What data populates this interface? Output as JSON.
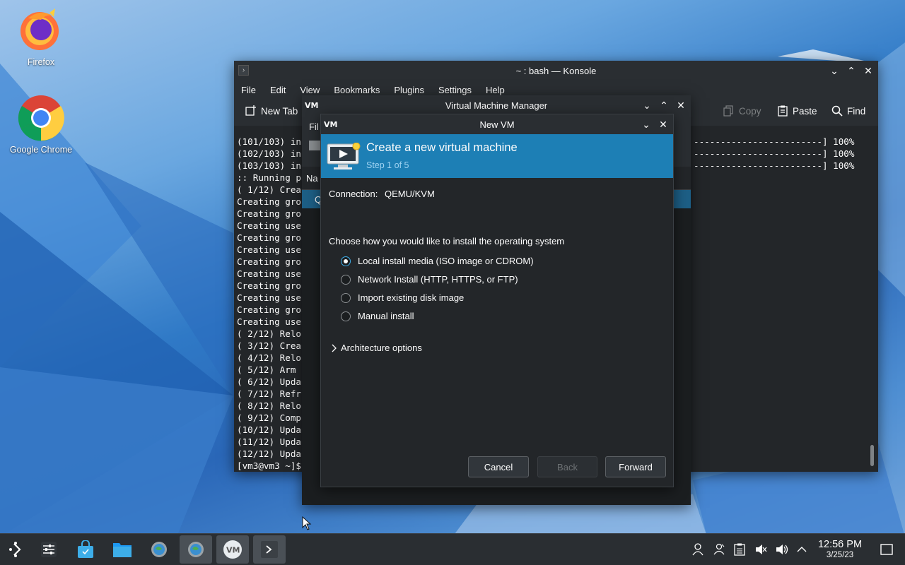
{
  "desktop": {
    "icons": [
      {
        "label": "Firefox"
      },
      {
        "label": "Google Chrome"
      }
    ]
  },
  "konsole": {
    "title": "~ : bash — Konsole",
    "menu": [
      "File",
      "Edit",
      "View",
      "Bookmarks",
      "Plugins",
      "Settings",
      "Help"
    ],
    "toolbar": {
      "new_tab": "New Tab",
      "copy": "Copy",
      "paste": "Paste",
      "find": "Find"
    },
    "lines_left": [
      "(101/103) in",
      "(102/103) in",
      "(103/103) in",
      ":: Running p",
      "( 1/12) Crea",
      "Creating gro",
      "Creating gro",
      "Creating use",
      "Creating gro",
      "Creating use",
      "Creating gro",
      "Creating use",
      "Creating gro",
      "Creating use",
      "Creating gro",
      "Creating use",
      "( 2/12) Relo",
      "( 3/12) Crea",
      "( 4/12) Relo",
      "( 5/12) Arm",
      "( 6/12) Upda",
      "( 7/12) Refr",
      "( 8/12) Relo",
      "( 9/12) Comp",
      "(10/12) Upda",
      "(11/12) Upda",
      "(12/12) Upda",
      "[vm3@vm3 ~]$"
    ],
    "lines_right": [
      "------------------------] 100%",
      "------------------------] 100%",
      "------------------------] 100%"
    ]
  },
  "vmm": {
    "title": "Virtual Machine Manager",
    "menu_fragment": "Fil",
    "header_fragment": "Na",
    "row_fragment": "Q"
  },
  "newvm": {
    "title": "New VM",
    "banner_title": "Create a new virtual machine",
    "banner_step": "Step 1 of 5",
    "connection_label": "Connection:",
    "connection_value": "QEMU/KVM",
    "prompt": "Choose how you would like to install the operating system",
    "options": [
      {
        "label": "Local install media (ISO image or CDROM)",
        "checked": true
      },
      {
        "label": "Network Install (HTTP, HTTPS, or FTP)",
        "checked": false
      },
      {
        "label": "Import existing disk image",
        "checked": false
      },
      {
        "label": "Manual install",
        "checked": false
      }
    ],
    "architecture": "Architecture options",
    "buttons": {
      "cancel": "Cancel",
      "back": "Back",
      "forward": "Forward"
    }
  },
  "clock": {
    "time": "12:56 PM",
    "date": "3/25/23"
  },
  "colors": {
    "accent": "#3daee9",
    "banner": "#1d7fb5",
    "window": "#232629",
    "titlebar": "#2a2e32"
  }
}
